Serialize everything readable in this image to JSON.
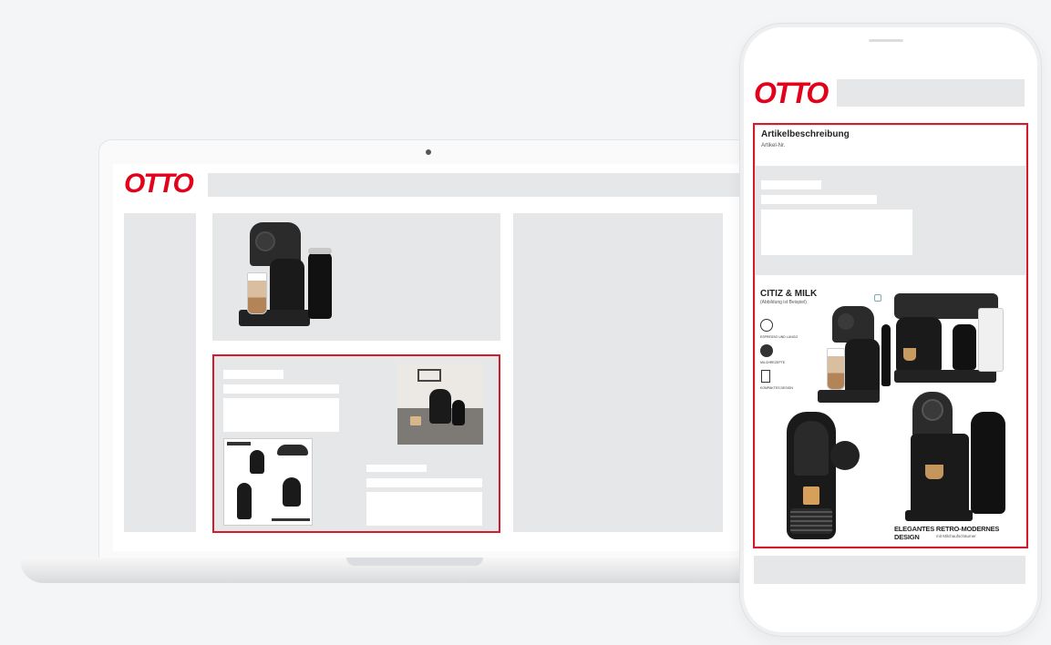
{
  "brand": {
    "logo_text": "OTTO",
    "logo_color": "#e2001a",
    "highlight_color": "#d7192c"
  },
  "phone": {
    "section_title": "Artikelbeschreibung",
    "article_label": "Artikel-Nr.",
    "product_title": "CITIZ & MILK",
    "product_subtitle": "(Abbildung ist Beispiel)",
    "feature_1": "ESPRESSO UND LUNGO",
    "feature_2": "MILCHREZEPTE",
    "feature_3": "KOMPAKTES DESIGN",
    "banner_title": "ELEGANTES RETRO-MODERNES DESIGN",
    "banner_subtitle": "mit Milchaufschäumer"
  },
  "icons": [
    "camera-icon",
    "expand-icon",
    "coffee-cup-icon",
    "milk-icon",
    "design-icon"
  ]
}
